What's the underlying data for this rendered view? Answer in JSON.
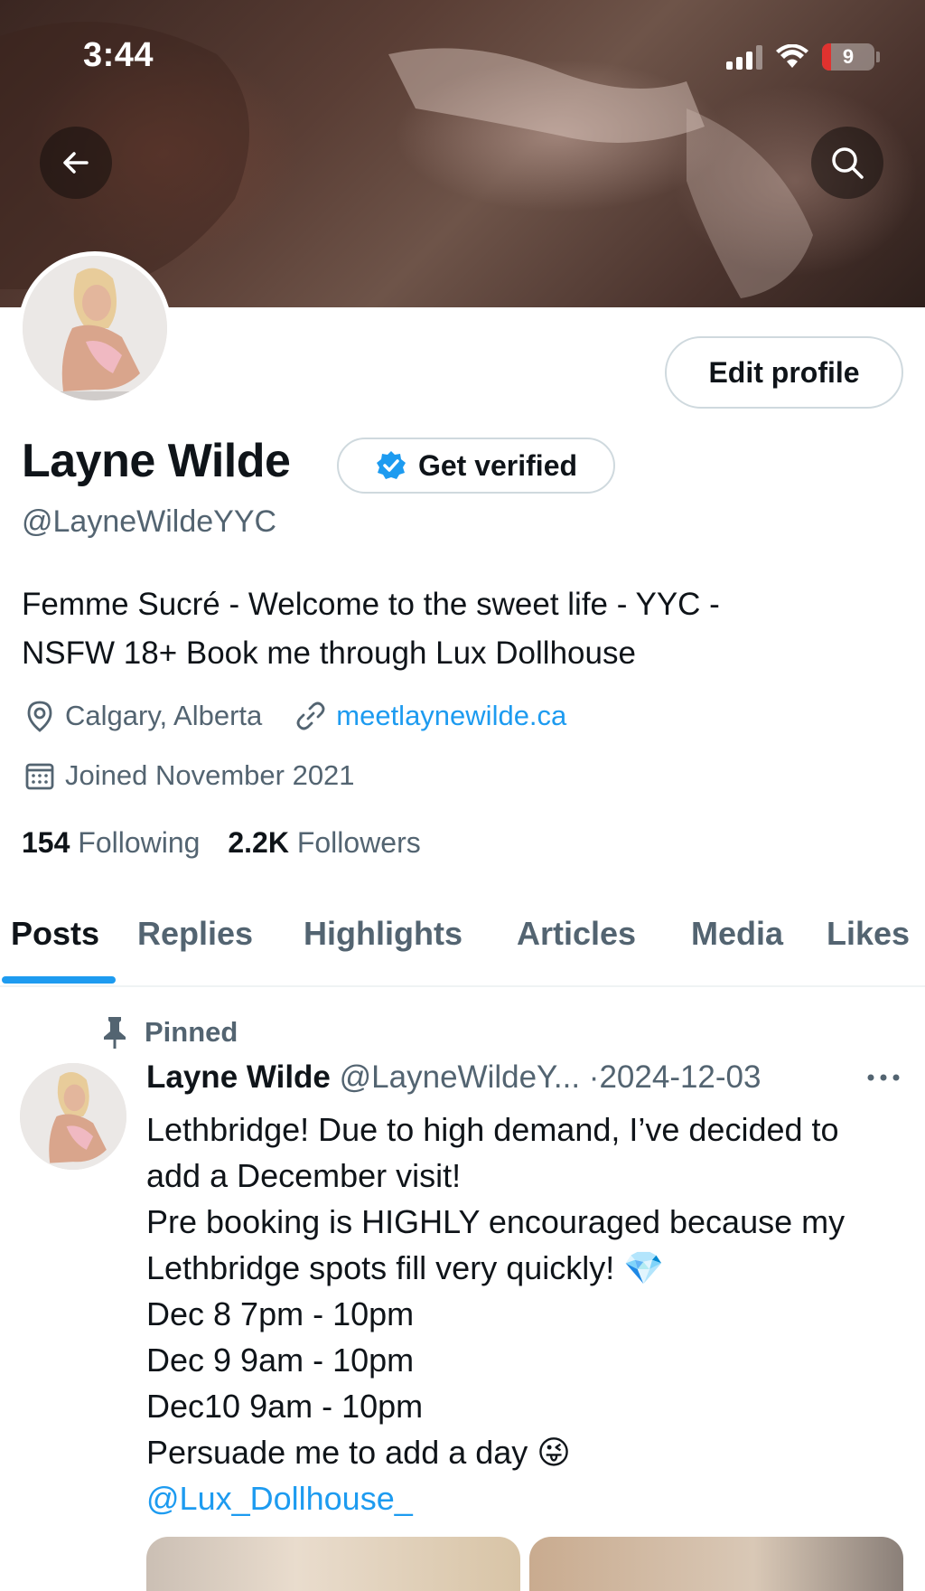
{
  "status_bar": {
    "time": "3:44",
    "battery": "9",
    "battery_color": "#e0322f"
  },
  "header": {
    "back_icon": "arrow-left-icon",
    "search_icon": "search-icon"
  },
  "profile": {
    "edit_label": "Edit profile",
    "name": "Layne Wilde",
    "verify_label": "Get verified",
    "handle": "@LayneWildeYYC",
    "bio_line1": "Femme Sucré - Welcome to the sweet life - YYC -",
    "bio_line2": "NSFW 18+ Book me through Lux Dollhouse",
    "location": "Calgary, Alberta",
    "website": "meetlaynewilde.ca",
    "joined": "Joined November 2021",
    "following_count": "154",
    "following_label": "Following",
    "followers_count": "2.2K",
    "followers_label": "Followers"
  },
  "tabs": [
    {
      "label": "Posts",
      "active": true
    },
    {
      "label": "Replies"
    },
    {
      "label": "Highlights"
    },
    {
      "label": "Articles"
    },
    {
      "label": "Media"
    },
    {
      "label": "Likes"
    }
  ],
  "pinned_post": {
    "pinned_label": "Pinned",
    "author": "Layne Wilde",
    "handle": "@LayneWildeY...",
    "separator": "·",
    "date": "2024-12-03",
    "lines": [
      "Lethbridge! Due to high demand, I’ve decided to",
      "add a December visit!",
      "Pre booking is HIGHLY encouraged because my",
      "Lethbridge spots fill very quickly! 💎",
      "Dec 8  7pm - 10pm",
      "Dec 9  9am - 10pm",
      "Dec10 9am - 10pm",
      "Persuade me to add a day 😜"
    ],
    "mention": "@Lux_Dollhouse_"
  },
  "colors": {
    "accent": "#1d9bf0",
    "text": "#0f1419",
    "secondary": "#536471",
    "border": "#cfd9de"
  }
}
